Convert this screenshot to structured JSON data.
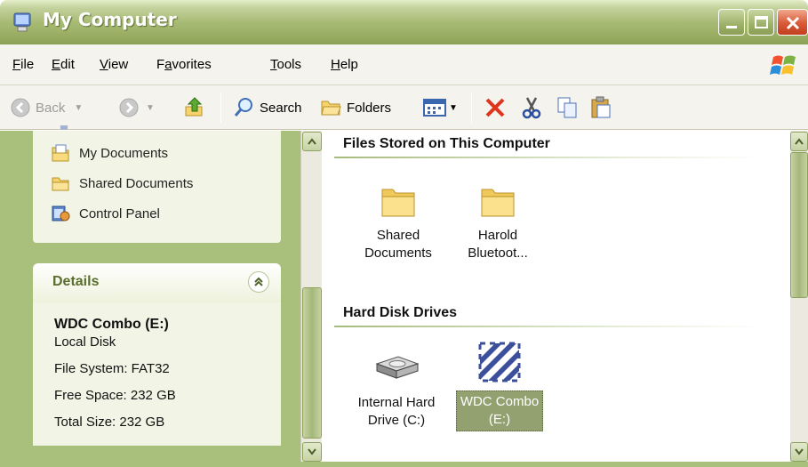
{
  "window": {
    "title": "My Computer"
  },
  "menu": [
    {
      "pre": "",
      "ul": "F",
      "post": "ile"
    },
    {
      "pre": "",
      "ul": "E",
      "post": "dit"
    },
    {
      "pre": "",
      "ul": "V",
      "post": "iew"
    },
    {
      "pre": "F",
      "ul": "a",
      "post": "vorites"
    },
    {
      "pre": "",
      "ul": "T",
      "post": "ools"
    },
    {
      "pre": "",
      "ul": "H",
      "post": "elp"
    }
  ],
  "toolbar": {
    "back_label": "Back",
    "search_label": "Search",
    "folders_label": "Folders"
  },
  "taskpane": {
    "links": [
      {
        "label": "My Documents",
        "icon": "my-documents-icon"
      },
      {
        "label": "Shared Documents",
        "icon": "folder-icon"
      },
      {
        "label": "Control Panel",
        "icon": "control-panel-icon"
      }
    ],
    "details": {
      "header": "Details",
      "name": "WDC Combo (E:)",
      "type": "Local Disk",
      "file_system": "File System: FAT32",
      "free_space": "Free Space: 232 GB",
      "total_size": "Total Size: 232 GB"
    }
  },
  "main": {
    "sections": [
      {
        "title": "Files Stored on This Computer",
        "items": [
          {
            "line1": "Shared",
            "line2": "Documents",
            "icon": "folder-icon"
          },
          {
            "line1": "Harold",
            "line2": "Bluetoot...",
            "icon": "folder-icon"
          }
        ]
      },
      {
        "title": "Hard Disk Drives",
        "items": [
          {
            "line1": "Internal Hard",
            "line2": "Drive (C:)",
            "icon": "hard-drive-icon"
          },
          {
            "line1": "WDC Combo",
            "line2": "(E:)",
            "icon": "wdc-drive-icon",
            "selected": true
          }
        ]
      }
    ]
  },
  "colors": {
    "titlebar": "#98ad62",
    "taskpane": "#a9c07d",
    "selection": "#93a070",
    "close": "#d85a36"
  }
}
